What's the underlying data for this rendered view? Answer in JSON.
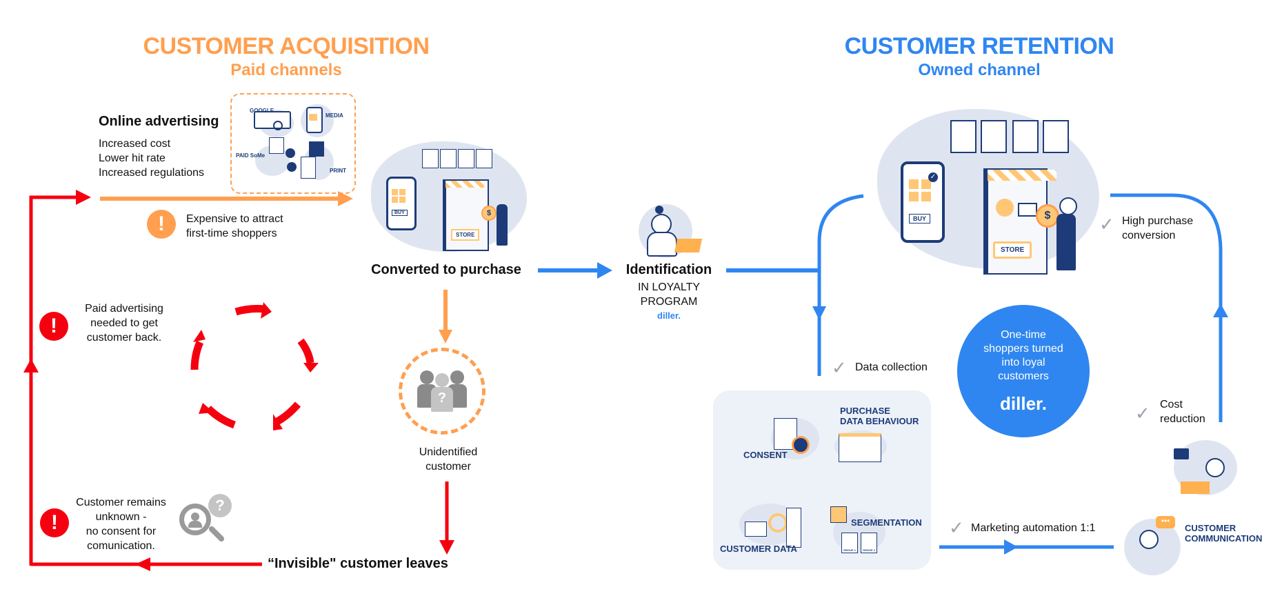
{
  "colors": {
    "acquisition": "#ff9f4f",
    "retention": "#2f86f0",
    "warning_red": "#f5000f",
    "illustration_bg": "#dfe5f0",
    "navy": "#1d3b78"
  },
  "acquisition": {
    "title": "CUSTOMER ACQUISITION",
    "subtitle": "Paid channels",
    "online_advertising": {
      "title": "Online advertising",
      "points": [
        "Increased cost",
        "Lower hit rate",
        "Increased regulations"
      ]
    },
    "channels": [
      "GOOGLE",
      "MEDIA",
      "PAID SoMe",
      "PRINT"
    ],
    "warning_expensive": [
      "Expensive to attract",
      "first-time shoppers"
    ],
    "converted_label": "Converted to purchase",
    "store_labels": {
      "buy": "BUY",
      "store": "STORE"
    },
    "unidentified_label": [
      "Unidentified",
      "customer"
    ],
    "warning_paid_back": [
      "Paid advertising",
      "needed to get",
      "customer back."
    ],
    "warning_unknown": [
      "Customer remains",
      "unknown -",
      "no consent for",
      "comunication."
    ],
    "invisible_leaves": "“Invisible\" customer leaves"
  },
  "identification": {
    "title": "Identification",
    "subtitle_lines": [
      "IN LOYALTY",
      "PROGRAM"
    ],
    "brand": "diller."
  },
  "retention": {
    "title": "CUSTOMER RETENTION",
    "subtitle": "Owned channel",
    "high_purchase": [
      "High purchase",
      "conversion"
    ],
    "data_collection": "Data collection",
    "loyal_circle": [
      "One-time",
      "shoppers turned",
      "into loyal",
      "customers"
    ],
    "loyal_brand": "diller.",
    "cost_reduction": [
      "Cost",
      "reduction"
    ],
    "marketing_automation": "Marketing automation 1:1",
    "data_panel": {
      "consent": "CONSENT",
      "purchase_behaviour": [
        "PURCHASE",
        "DATA BEHAVIOUR"
      ],
      "customer_data": "CUSTOMER DATA",
      "segmentation": "SEGMENTATION",
      "groups": [
        "GROUP 1",
        "GROUP 2"
      ]
    },
    "customer_communication": [
      "CUSTOMER",
      "COMMUNICATION"
    ]
  },
  "icons": {
    "warning": "!",
    "check": "✓",
    "question": "?",
    "dollar": "$"
  }
}
